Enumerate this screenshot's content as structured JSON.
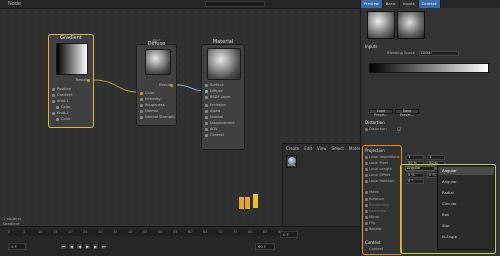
{
  "node_editor": {
    "mode_label": "Node",
    "search_placeholder": "Search"
  },
  "nodes": {
    "gradient": {
      "title": "Gradient",
      "output": "Result",
      "ports": [
        "Position",
        "Gradient",
        "Knot.1",
        "Color",
        "Knot.2",
        "Color"
      ]
    },
    "diffuse": {
      "subtitle": "BSDF",
      "title": "Diffuse",
      "output": "Result",
      "ports": [
        "Color",
        "Intensity",
        "Roughness",
        "Normal",
        "Normal Strength"
      ]
    },
    "material": {
      "title": "Material",
      "ports": [
        "Surface",
        "Diffuse",
        "BSDF Layer",
        "Emission",
        "Alpha",
        "Normal",
        "Displacement",
        "AOV",
        "Context"
      ]
    }
  },
  "node_info": {
    "line1": "1 node(s)",
    "line2": "Gradient",
    "line3": "Gradient",
    "line4": "17 Knn - 1640"
  },
  "browser": {
    "menu": [
      "Create",
      "Edit",
      "View",
      "Select",
      "Material"
    ],
    "item_label": "Node"
  },
  "timeline": {
    "ticks": [
      "0",
      "5",
      "10",
      "15",
      "20",
      "25",
      "30",
      "35",
      "40",
      "45",
      "50",
      "55",
      "60",
      "65",
      "70",
      "75",
      "80",
      "85",
      "90"
    ],
    "frame_start": "0 F",
    "frame_end": "90 F",
    "frame_current": "0 F",
    "transport": [
      "⏮",
      "◀",
      "◀",
      "▶",
      "▶",
      "⏭"
    ]
  },
  "attr_panel": {
    "tabs": [
      "Preview",
      "Basic",
      "Inputs",
      "Context"
    ],
    "active_tab": "Context",
    "inputs_header": "Inputs",
    "blending_space_label": "Blending Space",
    "blending_space_value": "Linear",
    "load_preset": "Load Preset...",
    "save_preset": "Save Preset...",
    "distortion_header": "Distortion",
    "distortion_label": "Distortion",
    "projection_header": "Projection",
    "projection_rows": [
      {
        "name": "Local Repetitions",
        "v1": "1",
        "v2": "1"
      },
      {
        "name": "Local Pixel",
        "v1": "50 %",
        "v2": "50 %"
      },
      {
        "name": "Local Length",
        "v1": "50 %",
        "v2": "50 %"
      },
      {
        "name": "Local Offset",
        "v1": "0 %",
        "v2": "0 %"
      },
      {
        "name": "Local Rotation",
        "v1": "0 °",
        "v2": ""
      }
    ],
    "mode_label": "Mode",
    "mode_value": "Angular",
    "side_labels": [
      "Rotation",
      "Randomize",
      "Cartesian",
      "Mirror",
      "Flip",
      "Repeat"
    ],
    "context_header": "Context",
    "context_label": "Context"
  },
  "mode_options": [
    "Angular",
    "Angular",
    "Radial",
    "Circular",
    "Box",
    "Star",
    "N-Angle"
  ],
  "colors": {
    "highlight_orange": "#e6892a",
    "highlight_green": "#b4d83a",
    "accent_blue": "#3a6aa8",
    "selection_gold": "#d8b64a"
  }
}
